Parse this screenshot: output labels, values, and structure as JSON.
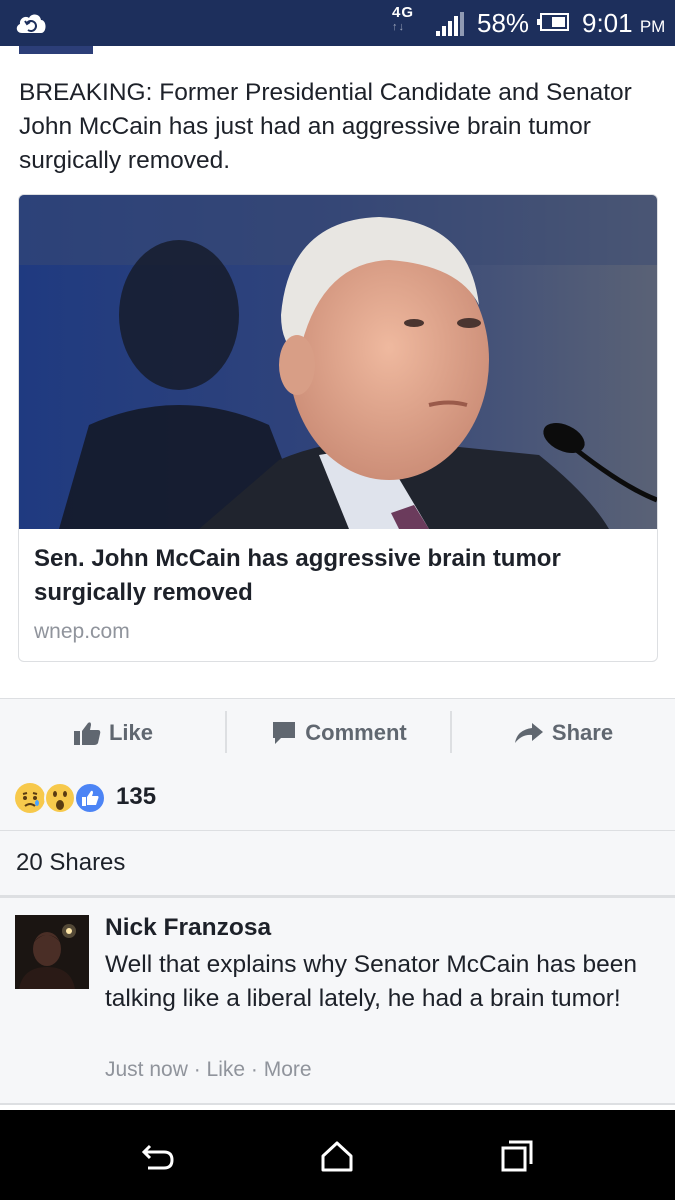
{
  "status_bar": {
    "network": "4G",
    "battery_percent": "58%",
    "time": "9:01",
    "time_suffix": "PM",
    "icons": [
      "cloud-sync-icon",
      "signal-icon",
      "battery-icon"
    ]
  },
  "post": {
    "text": "BREAKING: Former Presidential Candidate and Senator John McCain has just had an aggressive brain tumor surgically removed.",
    "link": {
      "title": "Sen. John McCain has aggressive brain tumor surgically removed",
      "domain": "wnep.com"
    }
  },
  "actions": {
    "like_label": "Like",
    "comment_label": "Comment",
    "share_label": "Share"
  },
  "reactions": {
    "count": "135",
    "types": [
      "sad",
      "wow",
      "like"
    ]
  },
  "shares": {
    "label": "20 Shares"
  },
  "comment": {
    "author": "Nick Franzosa",
    "text": "Well that explains why Senator McCain has been talking like a liberal lately, he had a brain tumor!",
    "time": "Just now",
    "like_label": "Like",
    "more_label": "More",
    "separator": " · "
  },
  "colors": {
    "status_bar": "#1d2f5c",
    "action_text": "#606770",
    "meta_text": "#90949c",
    "like_blue": "#4c84f5"
  }
}
